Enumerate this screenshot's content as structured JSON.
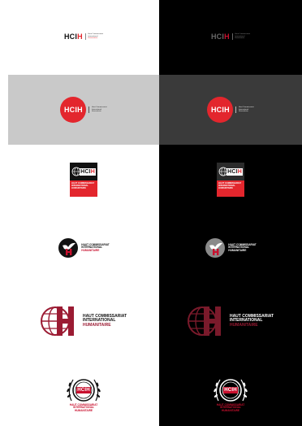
{
  "brand": {
    "acronym_prefix": "HCI",
    "acronym_suffix": "H",
    "full_line1": "HAUT COMMISSARIAT",
    "full_line2": "INTERNATIONAL",
    "full_line3": "HUMANITAIRE",
    "small_line1": "Haut Commissariat",
    "small_line2": "International",
    "small_line3": "Humanitaire"
  },
  "colors": {
    "red": "#e3262d",
    "dark_red": "#9b1b33",
    "crimson": "#c8102e",
    "black": "#000000",
    "white": "#ffffff",
    "grey": "#c9c9c9",
    "dark_grey": "#3a3a3a"
  },
  "variants": [
    {
      "row": 1,
      "name": "horizontal-wordmark"
    },
    {
      "row": 2,
      "name": "circle-badge"
    },
    {
      "row": 3,
      "name": "square-block"
    },
    {
      "row": 4,
      "name": "dove-emblem"
    },
    {
      "row": 5,
      "name": "globe-h-emblem"
    },
    {
      "row": 6,
      "name": "laurel-seal"
    }
  ]
}
